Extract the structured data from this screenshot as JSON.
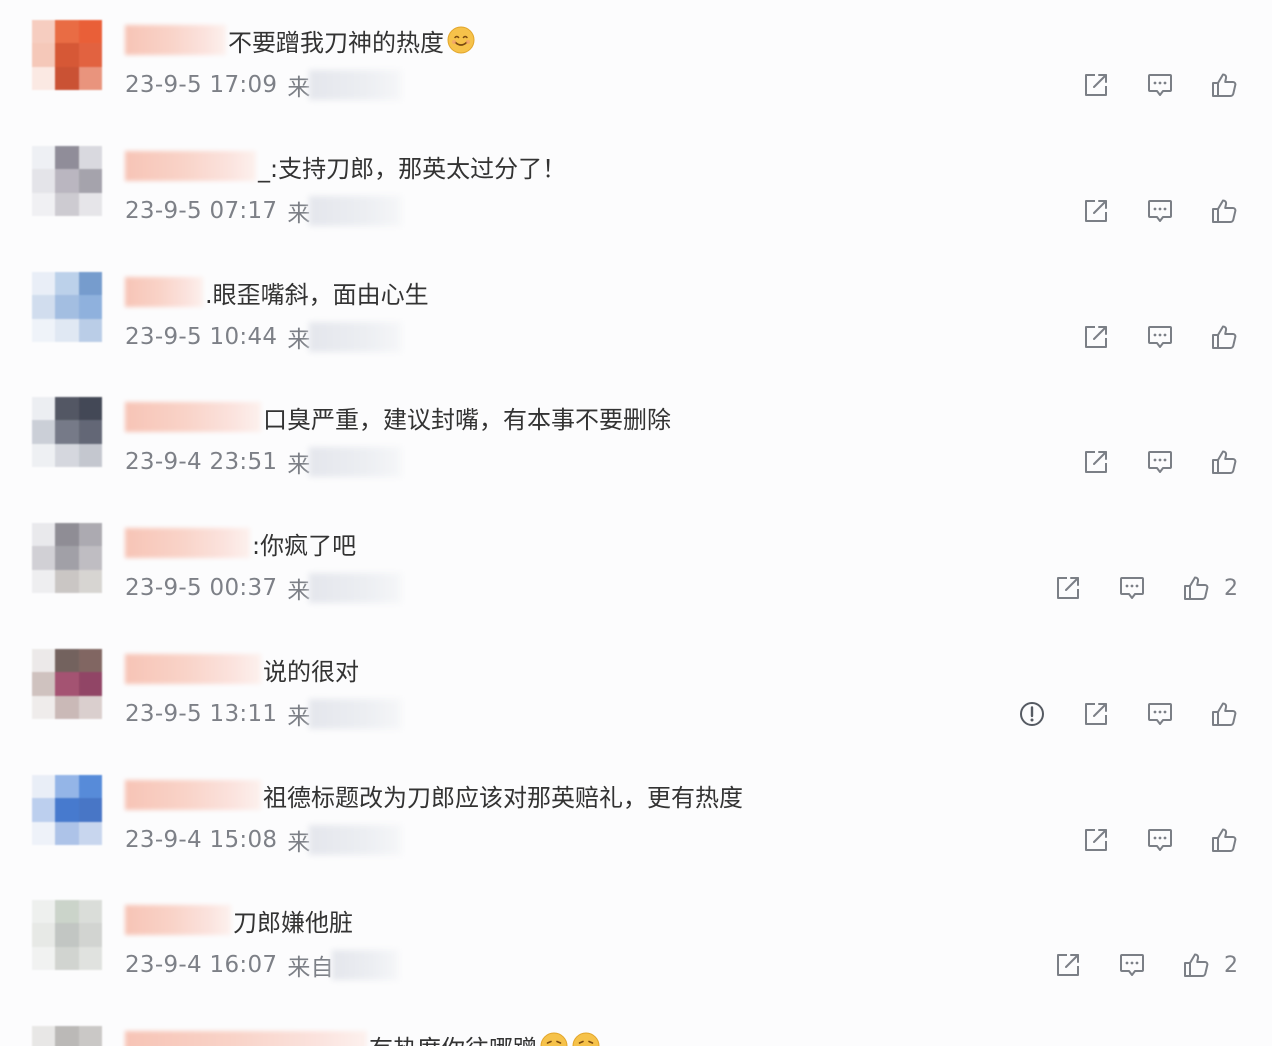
{
  "colors": {
    "text": "#333333",
    "meta": "#7d8087",
    "icon": "#7b7f86",
    "background": "#fcfcfd",
    "emoji": "#f6c24a"
  },
  "actions": [
    "share-icon",
    "comment-icon",
    "like-icon"
  ],
  "comments": [
    {
      "text": "不要蹭我刀神的热度",
      "emoji": "smile",
      "time": "23-9-5 17:09",
      "source": "来",
      "likes": "",
      "avatar_colors": [
        "#f6cbbd",
        "#e8653b",
        "#e9572e",
        "#f5c6b6",
        "#d4502c",
        "#e15a36",
        "#fbe8e2",
        "#c8492a",
        "#e88f77"
      ]
    },
    {
      "text": "_:支持刀郎，那英太过分了！",
      "time": "23-9-5 07:17",
      "source": "来",
      "likes": "",
      "avatar_colors": [
        "#eef0f4",
        "#8b8894",
        "#d8d8de",
        "#e3e3e8",
        "#b7b3bd",
        "#a19fa8",
        "#f0f0f3",
        "#cbc9cf",
        "#e5e4e8"
      ]
    },
    {
      "text": ".眼歪嘴斜，面由心生",
      "time": "23-9-5 10:44",
      "source": "来",
      "likes": "",
      "avatar_colors": [
        "#e8eef7",
        "#b9cfe9",
        "#6f97cb",
        "#cfdcee",
        "#9fbbe0",
        "#8aaedc",
        "#eff3f9",
        "#dfe7f3",
        "#b7cbe6"
      ]
    },
    {
      "text": "口臭严重，建议封嘴，有本事不要删除",
      "time": "23-9-4 23:51",
      "source": "来",
      "likes": "",
      "avatar_colors": [
        "#eceef2",
        "#4b4f5c",
        "#3a3f4e",
        "#c9cdd6",
        "#6f7482",
        "#5b606f",
        "#eef0f3",
        "#d3d6dd",
        "#c2c5cd"
      ]
    },
    {
      "text": ":你疯了吧",
      "time": "23-9-5 00:37",
      "source": "来",
      "likes": "2",
      "avatar_colors": [
        "#e8e8ec",
        "#8a8890",
        "#a8a6ad",
        "#cfced3",
        "#9d9ca3",
        "#bcbabf",
        "#eeeef0",
        "#c8c4c2",
        "#d6d3d0"
      ]
    },
    {
      "text": "说的很对",
      "time": "23-9-5 13:11",
      "source": "来",
      "likes": "",
      "report": true,
      "avatar_colors": [
        "#ece9e8",
        "#6c5a56",
        "#7b5f5a",
        "#cdbfbc",
        "#a04a6b",
        "#8c3c5e",
        "#efeceb",
        "#c8b6b4",
        "#d9cdcc"
      ]
    },
    {
      "text": "祖德标题改为刀郎应该对那英赔礼，更有热度",
      "time": "23-9-4 15:08",
      "source": "来",
      "likes": "",
      "avatar_colors": [
        "#e9eef7",
        "#8fb2e6",
        "#4f86d8",
        "#b9cdee",
        "#3e74cc",
        "#3f6fc4",
        "#eef2f9",
        "#a9c0e7",
        "#c6d5ee"
      ]
    },
    {
      "text": "刀郎嫌他脏",
      "time": "23-9-4 16:07",
      "source": "来自",
      "likes": "2",
      "avatar_colors": [
        "#eef0ee",
        "#c9d2c8",
        "#d9dcd8",
        "#e6e8e5",
        "#bfc4c0",
        "#d0d2cf",
        "#f1f2f1",
        "#cfd2ce",
        "#dfe1de"
      ]
    },
    {
      "text": "有热度你往哪蹭",
      "emoji": "laugh",
      "time": "",
      "source": "",
      "likes": "",
      "avatar_colors": [
        "#e7e6e5",
        "#b8b6b4",
        "#c8c6c4",
        "#eeeeed",
        "#c2c0be",
        "#d2d0ce",
        "#f2f2f1",
        "#d8d6d4",
        "#e4e2e0"
      ]
    }
  ]
}
